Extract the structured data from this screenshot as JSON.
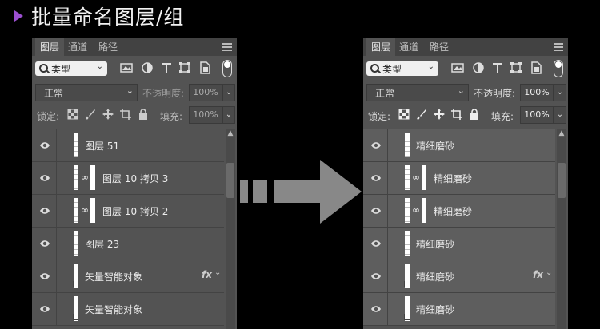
{
  "title": "批量命名图层/组",
  "colors": {
    "accent": "#9b4fd0",
    "panel": "#535353",
    "tabbar": "#424242",
    "arrow": "#888888"
  },
  "panels": [
    {
      "tabs": [
        "图层",
        "通道",
        "路径"
      ],
      "filter_kind": "类型",
      "blend_mode": "正常",
      "opacity_label": "不透明度:",
      "opacity_value": "100%",
      "lock_label": "锁定:",
      "fill_label": "填充:",
      "fill_value": "100%",
      "layers": [
        {
          "name": "图层 51",
          "type": "pixel",
          "linked": false,
          "fx": ""
        },
        {
          "name": "图层 10 拷贝 3",
          "type": "masked",
          "linked": true,
          "fx": ""
        },
        {
          "name": "图层 10 拷贝 2",
          "type": "masked",
          "linked": true,
          "fx": ""
        },
        {
          "name": "图层 23",
          "type": "pixel",
          "linked": false,
          "fx": ""
        },
        {
          "name": "矢量智能对象",
          "type": "smart",
          "linked": false,
          "fx": "fx"
        },
        {
          "name": "矢量智能对象",
          "type": "smart",
          "linked": false,
          "fx": ""
        }
      ]
    },
    {
      "tabs": [
        "图层",
        "通道",
        "路径"
      ],
      "filter_kind": "类型",
      "blend_mode": "正常",
      "opacity_label": "不透明度:",
      "opacity_value": "100%",
      "lock_label": "锁定:",
      "fill_label": "填充:",
      "fill_value": "100%",
      "layers": [
        {
          "name": "精细磨砂",
          "type": "pixel",
          "linked": false,
          "fx": ""
        },
        {
          "name": "精细磨砂",
          "type": "masked",
          "linked": true,
          "fx": ""
        },
        {
          "name": "精细磨砂",
          "type": "masked",
          "linked": true,
          "fx": ""
        },
        {
          "name": "精细磨砂",
          "type": "pixel",
          "linked": false,
          "fx": ""
        },
        {
          "name": "精细磨砂",
          "type": "smart",
          "linked": false,
          "fx": "fx"
        },
        {
          "name": "精细磨砂",
          "type": "smart",
          "linked": false,
          "fx": ""
        }
      ]
    }
  ]
}
